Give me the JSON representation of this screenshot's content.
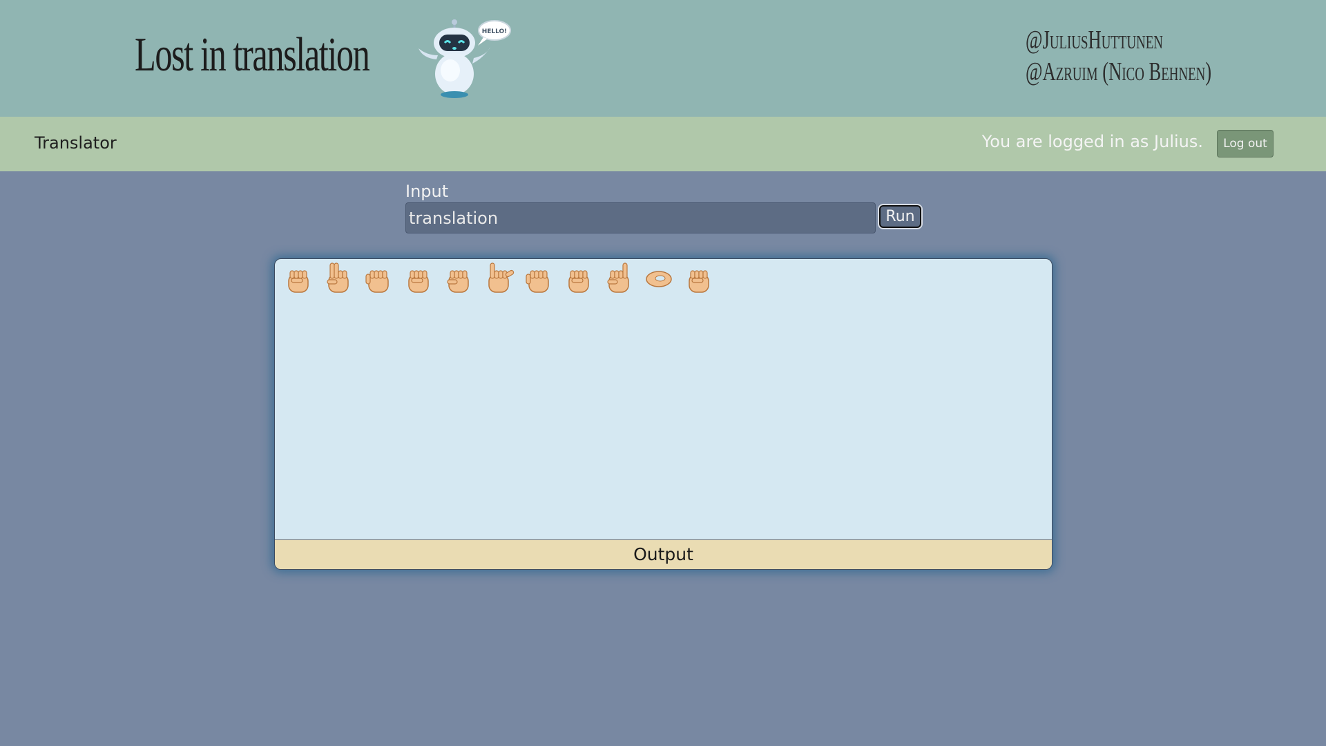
{
  "header": {
    "title": "Lost in translation",
    "robot_bubble": "HELLO!",
    "authors": [
      "@JuliusHuttunen",
      "@Azruim (Nico Behnen)"
    ]
  },
  "navbar": {
    "brand": "Translator",
    "login_status": "You are logged in as Julius.",
    "logout_label": "Log out"
  },
  "translator": {
    "input_label": "Input",
    "input_value": "translation",
    "run_label": "Run"
  },
  "output": {
    "label": "Output",
    "sign_letters": [
      "t",
      "r",
      "a",
      "n",
      "s",
      "l",
      "a",
      "t",
      "i",
      "o",
      "n"
    ]
  },
  "colors": {
    "header_bg": "#90b5b2",
    "navbar_bg": "#b0c8aa",
    "page_bg": "#7888a2",
    "output_bg": "#d5e8f2",
    "output_footer_bg": "#eadcb3",
    "skin": "#f1c08f"
  }
}
